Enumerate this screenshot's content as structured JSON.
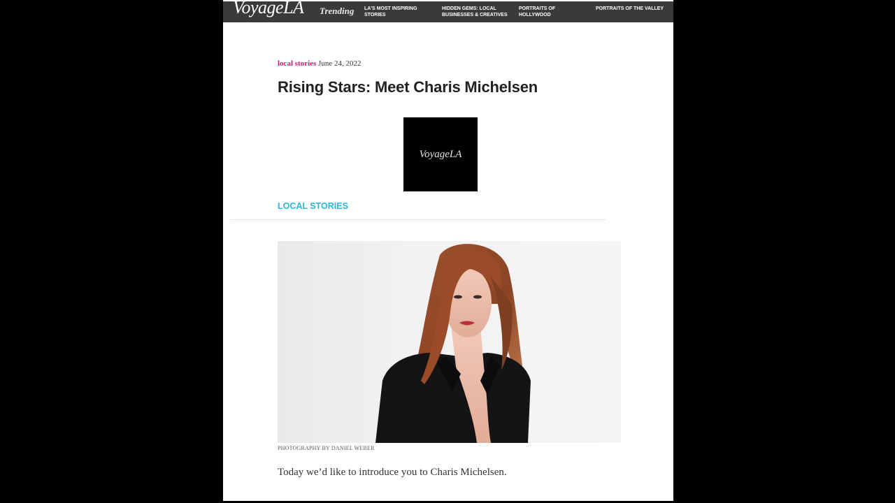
{
  "header": {
    "logo": "VoyageLA",
    "trending_label": "Trending",
    "nav": [
      {
        "label": "LA's Most Inspiring Stories"
      },
      {
        "label": "Hidden Gems: Local Businesses & Creatives"
      },
      {
        "label": "Portraits of Hollywood"
      },
      {
        "label": "Portraits of the Valley"
      }
    ]
  },
  "article": {
    "category": "local stories",
    "date": "June 24, 2022",
    "title": "Rising Stars: Meet Charis Michelsen",
    "logo_box_text": "VoyageLA",
    "section_label": "Local Stories",
    "photo_caption": "Photography by Daniel Weber",
    "intro": "Today we’d like to introduce you to Charis Michelsen."
  },
  "colors": {
    "background": "#000000",
    "nav_bar": "#3a3a3a",
    "category_accent": "#d4176e",
    "section_accent": "#2bb6dc"
  }
}
